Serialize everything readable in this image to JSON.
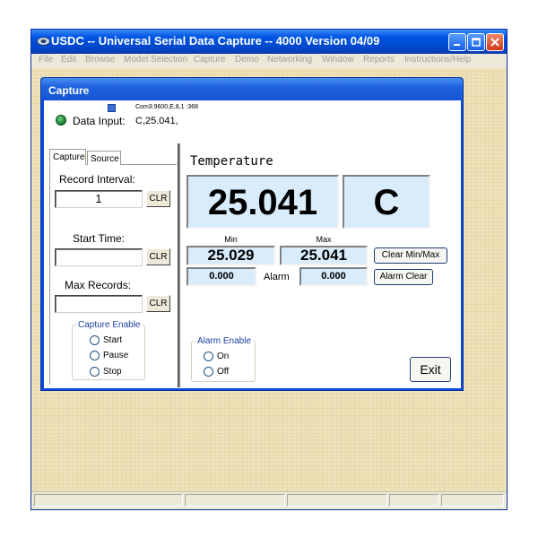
{
  "app": {
    "title": "USDC -- Universal Serial Data Capture -- 4000   Version 04/09"
  },
  "menu": {
    "items": [
      "File",
      "Edit",
      "Browse",
      "Model Selection",
      "Capture",
      "Demo",
      "Networking",
      "Window",
      "Reports",
      "Instructions/Help"
    ]
  },
  "capture_window": {
    "title": "Capture",
    "com_settings": "Com3:9600,E,8,1 :368",
    "data_input_label": "Data Input:",
    "data_input_value": "C,25.041,"
  },
  "tabs": {
    "capture": "Capture",
    "source": "Source"
  },
  "record_interval": {
    "label": "Record Interval:",
    "value": "1",
    "clr": "CLR"
  },
  "start_time": {
    "label": "Start Time:",
    "value": "",
    "clr": "CLR"
  },
  "max_records": {
    "label": "Max Records:",
    "value": "",
    "clr": "CLR"
  },
  "capture_enable": {
    "title": "Capture Enable",
    "options": [
      "Start",
      "Pause",
      "Stop"
    ]
  },
  "alarm_enable": {
    "title": "Alarm Enable",
    "options": [
      "On",
      "Off"
    ]
  },
  "reading": {
    "label": "Temperature",
    "value": "25.041",
    "unit": "C",
    "min_label": "Min",
    "max_label": "Max",
    "min_value": "25.029",
    "max_value": "25.041",
    "alarm_label": "Alarm",
    "alarm_low": "0.000",
    "alarm_high": "0.000"
  },
  "buttons": {
    "clear_minmax": "Clear Min/Max",
    "alarm_clear": "Alarm Clear",
    "exit": "Exit"
  },
  "colors": {
    "title_bar": "#0055e5",
    "display_background": "#d8ecfc",
    "status_led": "#1f9a3c"
  }
}
